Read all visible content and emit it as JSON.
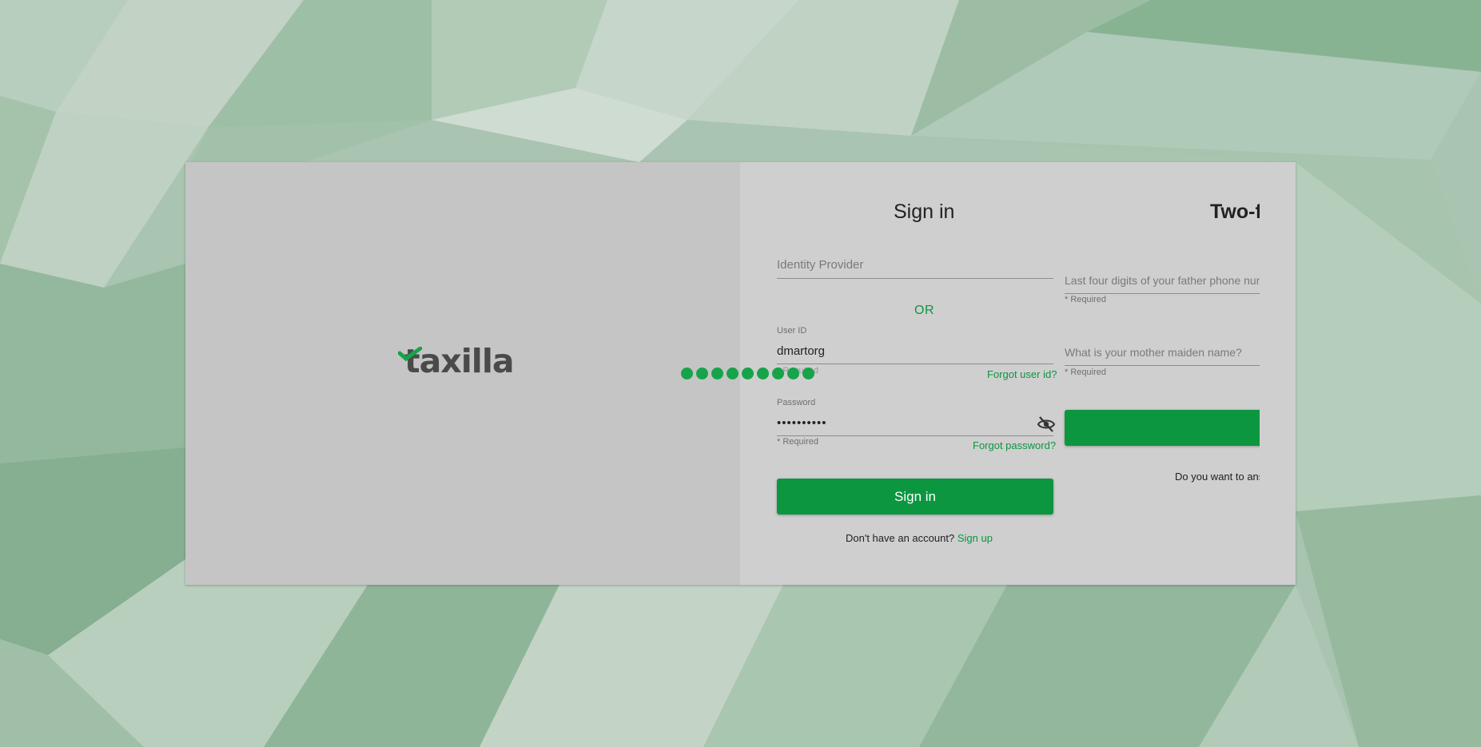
{
  "logo": {
    "text": "taxilla"
  },
  "signin": {
    "title": "Sign in",
    "identity_provider_placeholder": "Identity Provider",
    "or_text": "OR",
    "user_id_label": "User ID",
    "user_id_value": "dmartorg",
    "user_id_required": "* Required",
    "forgot_user_id": "Forgot user id?",
    "password_label": "Password",
    "password_value": "••••••••••",
    "password_required": "* Required",
    "forgot_password": "Forgot password?",
    "signin_button": "Sign in",
    "no_account_text": "Don't have an account?",
    "signup_link": "Sign up"
  },
  "twofa": {
    "title": "Two-fact",
    "question1_placeholder": "Last four digits of your father phone num",
    "question1_required": "* Required",
    "question2_placeholder": "What is your mother maiden name?",
    "question2_required": "* Required",
    "submit_button": "",
    "prompt_text": "Do you want to ans"
  },
  "loading": {
    "dot_count": 9
  },
  "colors": {
    "accent": "#0c9640",
    "card_bg": "#cfcfcf",
    "left_pane_bg": "#c5c5c5",
    "background": "#a9c4b1"
  },
  "icons": {
    "password_toggle": "eye-off-icon",
    "logo_mark": "check-icon"
  }
}
